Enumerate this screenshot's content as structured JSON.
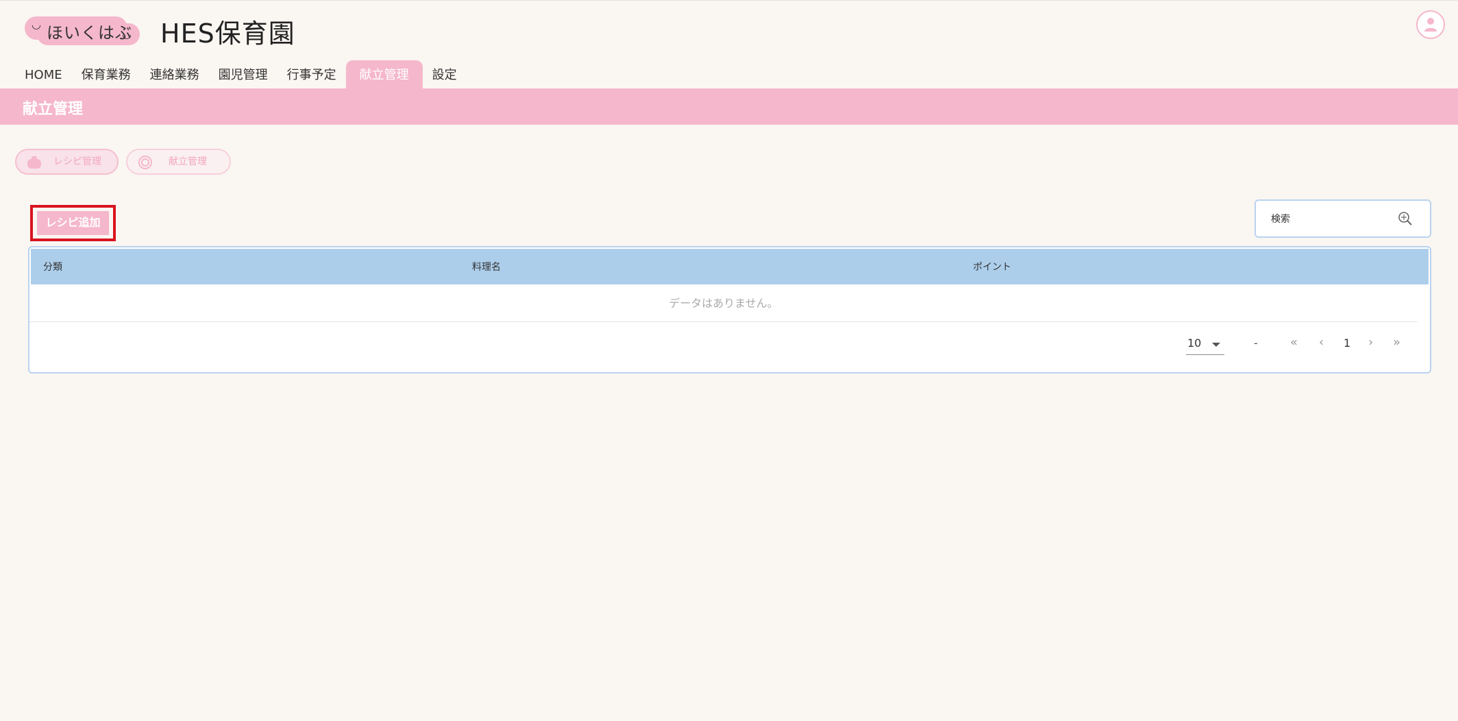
{
  "logo": {
    "text": "ほいくはぶ",
    "smile_left": "◡",
    "smile_right": "◡"
  },
  "header": {
    "title": "HES保育園"
  },
  "nav": {
    "items": [
      {
        "label": "HOME"
      },
      {
        "label": "保育業務"
      },
      {
        "label": "連絡業務"
      },
      {
        "label": "園児管理"
      },
      {
        "label": "行事予定"
      },
      {
        "label": "献立管理",
        "active": true
      },
      {
        "label": "設定"
      }
    ]
  },
  "page": {
    "title": "献立管理"
  },
  "subtabs": {
    "recipe": "レシピ管理",
    "menu": "献立管理"
  },
  "toolbar": {
    "add_label": "レシピ追加"
  },
  "search": {
    "placeholder": "検索"
  },
  "table": {
    "columns": [
      "分類",
      "料理名",
      "ポイント"
    ],
    "rows": [],
    "empty_text": "データはありません。"
  },
  "pagination": {
    "per_page": "10",
    "range": "-",
    "current_page": "1",
    "first": "«",
    "prev": "‹",
    "next": "›",
    "last": "»"
  },
  "colors": {
    "accent_pink": "#f5b7cb",
    "table_header_blue": "#acceeb",
    "background": "#faf6f2",
    "highlight_red": "#d8141f"
  }
}
